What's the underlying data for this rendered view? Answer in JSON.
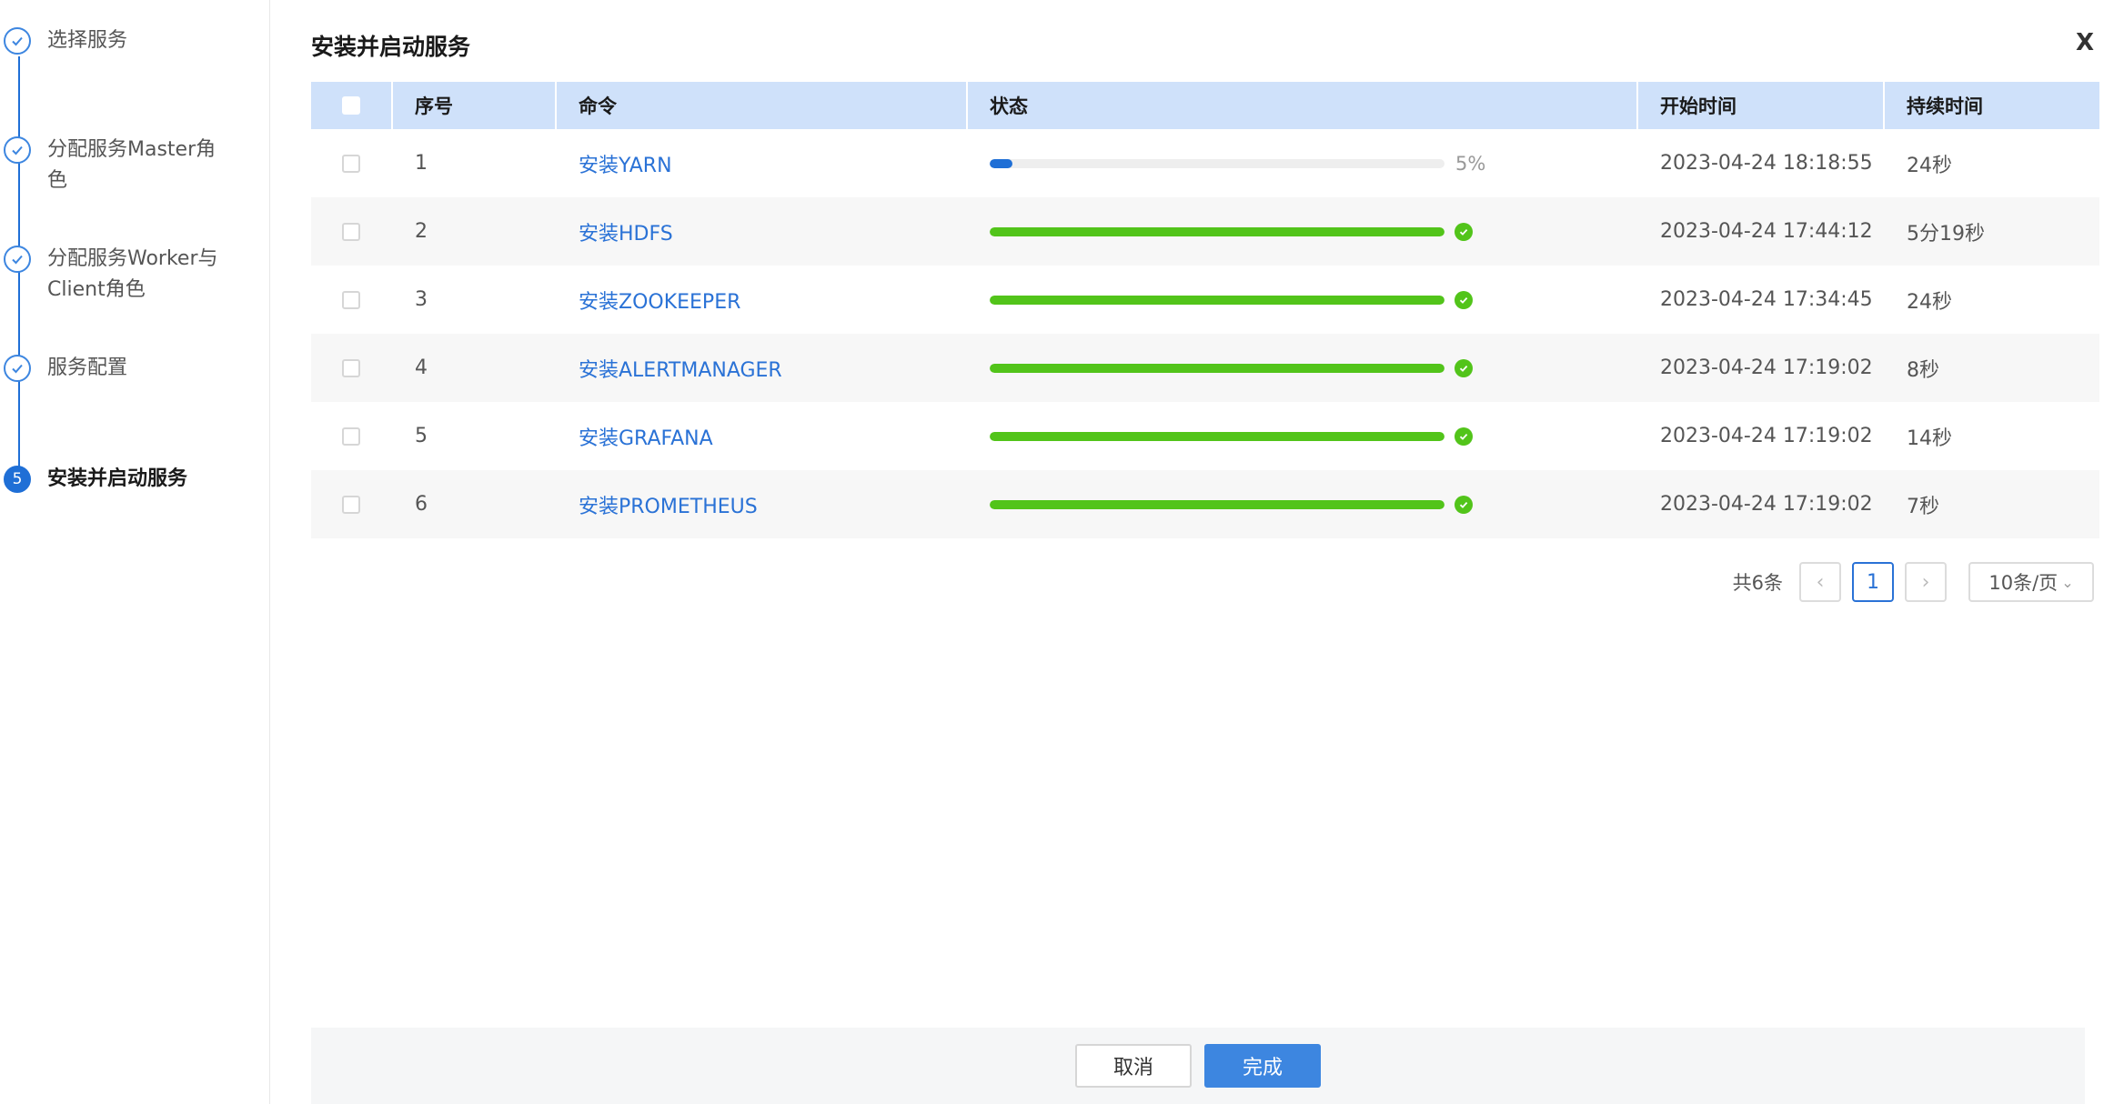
{
  "sidebar": {
    "steps": [
      {
        "label": "选择服务",
        "state": "done"
      },
      {
        "label": "分配服务Master角色",
        "state": "done"
      },
      {
        "label": "分配服务Worker与Client角色",
        "state": "done"
      },
      {
        "label": "服务配置",
        "state": "done"
      },
      {
        "label": "安装并启动服务",
        "state": "active",
        "number": "5"
      }
    ]
  },
  "dialog": {
    "title": "安装并启动服务",
    "close_label": "X"
  },
  "table": {
    "headers": {
      "index": "序号",
      "command": "命令",
      "status": "状态",
      "start_time": "开始时间",
      "duration": "持续时间"
    },
    "rows": [
      {
        "index": "1",
        "command": "安装YARN",
        "progress": 0.05,
        "progress_text": "5%",
        "done": false,
        "start_time": "2023-04-24 18:18:55",
        "duration": "24秒"
      },
      {
        "index": "2",
        "command": "安装HDFS",
        "progress": 1.0,
        "progress_text": "",
        "done": true,
        "start_time": "2023-04-24 17:44:12",
        "duration": "5分19秒"
      },
      {
        "index": "3",
        "command": "安装ZOOKEEPER",
        "progress": 1.0,
        "progress_text": "",
        "done": true,
        "start_time": "2023-04-24 17:34:45",
        "duration": "24秒"
      },
      {
        "index": "4",
        "command": "安装ALERTMANAGER",
        "progress": 1.0,
        "progress_text": "",
        "done": true,
        "start_time": "2023-04-24 17:19:02",
        "duration": "8秒"
      },
      {
        "index": "5",
        "command": "安装GRAFANA",
        "progress": 1.0,
        "progress_text": "",
        "done": true,
        "start_time": "2023-04-24 17:19:02",
        "duration": "14秒"
      },
      {
        "index": "6",
        "command": "安装PROMETHEUS",
        "progress": 1.0,
        "progress_text": "",
        "done": true,
        "start_time": "2023-04-24 17:19:02",
        "duration": "7秒"
      }
    ]
  },
  "pagination": {
    "total_text": "共6条",
    "prev_icon": "chevron-left-icon",
    "current_page": "1",
    "next_icon": "chevron-right-icon",
    "page_size": "10条/页"
  },
  "footer": {
    "cancel_label": "取消",
    "done_label": "完成"
  },
  "colors": {
    "accent": "#1f6fd6",
    "link": "#2a72d6",
    "progress_running": "#1f6fd6",
    "progress_done": "#52c41a",
    "header_bg": "#cfe1fa"
  }
}
